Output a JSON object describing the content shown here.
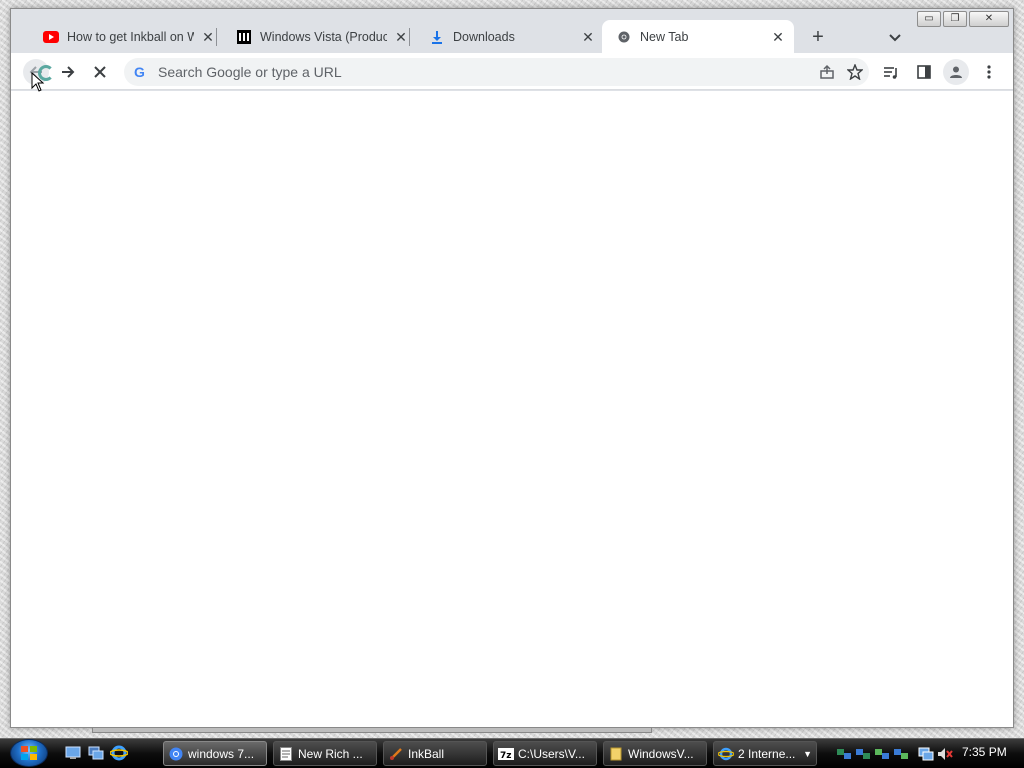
{
  "browser": {
    "tabs": [
      {
        "title": "How to get Inkball on W",
        "favicon": "youtube-icon",
        "active": false
      },
      {
        "title": "Windows Vista (Product",
        "favicon": "museum-icon",
        "active": false
      },
      {
        "title": "Downloads",
        "favicon": "download-icon",
        "active": false
      },
      {
        "title": "New Tab",
        "favicon": "chrome-icon",
        "active": true
      }
    ],
    "new_tab_glyph": "+",
    "tab_search_glyph": "⌄",
    "close_glyph": "✕",
    "caption": {
      "minimize": "▭",
      "restore": "❐",
      "close": "✕"
    },
    "omnibox": {
      "g_logo": "G",
      "placeholder": "Search Google or type a URL"
    }
  },
  "taskbar": {
    "tasks": [
      {
        "label": "windows 7...",
        "icon": "chrome-icon",
        "active": true
      },
      {
        "label": "New Rich ...",
        "icon": "document-icon",
        "active": false
      },
      {
        "label": "InkBall",
        "icon": "inkball-icon",
        "active": false
      },
      {
        "label": "C:\\Users\\V...",
        "icon": "7zip-icon",
        "active": false
      },
      {
        "label": "WindowsV...",
        "icon": "folder-icon",
        "active": false
      },
      {
        "label": "2 Interne...",
        "icon": "ie-icon",
        "active": false
      }
    ],
    "clock": "7:35 PM"
  },
  "colors": {
    "tabstrip": "#dee1e6",
    "omnibox": "#f1f3f4",
    "taskbar": "#000000",
    "accent_blue": "#1a73e8"
  }
}
